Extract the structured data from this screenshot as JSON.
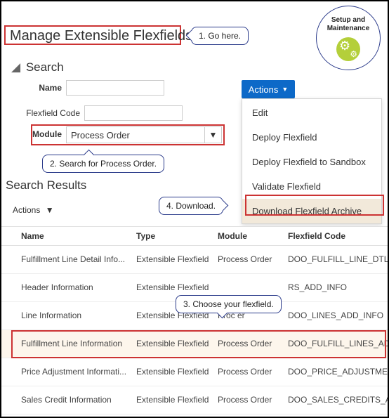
{
  "badge": {
    "line1": "Setup and",
    "line2": "Maintenance"
  },
  "page_title": "Manage Extensible Flexfields",
  "search_header": "Search",
  "labels": {
    "name": "Name",
    "flexfield_code": "Flexfield Code",
    "module": "Module"
  },
  "inputs": {
    "name": "",
    "flexfield_code": "",
    "module": "Process Order"
  },
  "actions_button": "Actions",
  "actions_menu": {
    "edit": "Edit",
    "deploy": "Deploy Flexfield",
    "deploy_sandbox": "Deploy Flexfield to Sandbox",
    "validate": "Validate Flexfield",
    "download": "Download Flexfield Archive"
  },
  "results_header": "Search Results",
  "results_actions": "Actions",
  "columns": {
    "name": "Name",
    "type": "Type",
    "module": "Module",
    "code": "Flexfield Code"
  },
  "rows": [
    {
      "name": "Fulfillment Line Detail Info...",
      "type": "Extensible Flexfield",
      "module": "Process Order",
      "code": "DOO_FULFILL_LINE_DTLS_ADD_..."
    },
    {
      "name": "Header Information",
      "type": "Extensible Flexfield",
      "module": "",
      "code": "RS_ADD_INFO"
    },
    {
      "name": "Line Information",
      "type": "Extensible Flexfield",
      "module": "Proc           er",
      "code": "DOO_LINES_ADD_INFO"
    },
    {
      "name": "Fulfillment Line Information",
      "type": "Extensible Flexfield",
      "module": "Process Order",
      "code": "DOO_FULFILL_LINES_ADD_INFO"
    },
    {
      "name": "Price Adjustment Informati...",
      "type": "Extensible Flexfield",
      "module": "Process Order",
      "code": "DOO_PRICE_ADJUSTMENTS_ADD"
    },
    {
      "name": "Sales Credit Information",
      "type": "Extensible Flexfield",
      "module": "Process Order",
      "code": "DOO_SALES_CREDITS_ADD_INF"
    }
  ],
  "callouts": {
    "c1": "1. Go here.",
    "c2": "2. Search for Process Order.",
    "c3": "3. Choose your flexfield.",
    "c4": "4. Download."
  }
}
